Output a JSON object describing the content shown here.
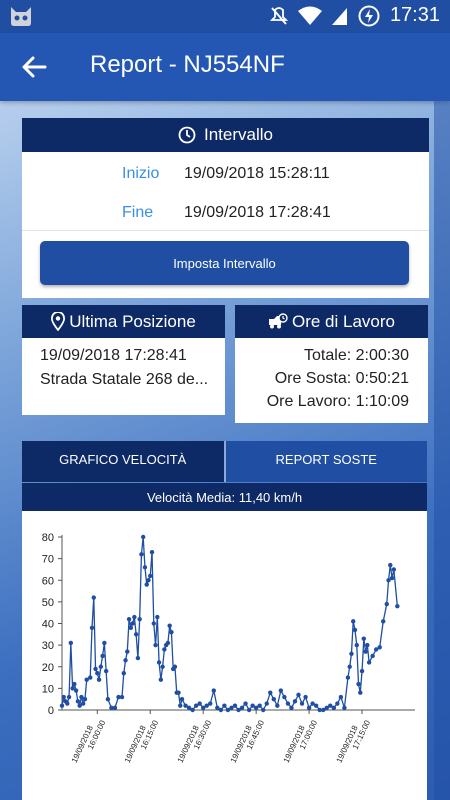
{
  "status_bar": {
    "time": "17:31",
    "icons": [
      "android-cat-icon",
      "mute-icon",
      "wifi-icon",
      "signal-icon",
      "battery-charging-icon"
    ]
  },
  "app_bar": {
    "title": "Report - NJ554NF",
    "back_icon": "arrow-left-icon"
  },
  "interval": {
    "header": "Intervallo",
    "icon": "clock-icon",
    "start_label": "Inizio",
    "start_value": "19/09/2018 15:28:11",
    "end_label": "Fine",
    "end_value": "19/09/2018 17:28:41",
    "button_label": "Imposta Intervallo"
  },
  "last_position": {
    "header": "Ultima Posizione",
    "icon": "location-pin-icon",
    "datetime": "19/09/2018 17:28:41",
    "address": "Strada Statale 268 de..."
  },
  "work_hours": {
    "header": "Ore di Lavoro",
    "icon": "truck-clock-icon",
    "total": "Totale: 2:00:30",
    "stop": "Ore Sosta: 0:50:21",
    "work": "Ore Lavoro: 1:10:09"
  },
  "tabs": [
    {
      "label": "GRAFICO VELOCITÀ",
      "active": true
    },
    {
      "label": "REPORT SOSTE",
      "active": false
    }
  ],
  "average_speed": "Velocità Media: 11,40 km/h",
  "colors": {
    "primary": "#1f4ea3",
    "dark_header": "#0d2a66",
    "accent_label": "#3a8ee6",
    "series": "#1f4ea3"
  },
  "chart_data": {
    "type": "line",
    "title": "",
    "xlabel": "",
    "ylabel": "",
    "ylim": [
      0,
      80
    ],
    "yticks": [
      0,
      10,
      20,
      30,
      40,
      50,
      60,
      70,
      80
    ],
    "x_tick_labels": [
      "19/09/2018 16:00:00",
      "19/09/2018 16:15:00",
      "19/09/2018 16:30:00",
      "19/09/2018 16:45:00",
      "19/09/2018 17:00:00",
      "19/09/2018 17:15:00"
    ],
    "x_range_minutes": [
      "15:50",
      "17:30"
    ],
    "series": [
      {
        "points": [
          [
            "15:50",
            2
          ],
          [
            "15:50:30",
            6
          ],
          [
            "15:51",
            4
          ],
          [
            "15:51:30",
            3
          ],
          [
            "15:52",
            6
          ],
          [
            "15:52:30",
            31
          ],
          [
            "15:53",
            10
          ],
          [
            "15:53:30",
            12
          ],
          [
            "15:54",
            9
          ],
          [
            "15:54:30",
            4
          ],
          [
            "15:55",
            2
          ],
          [
            "15:55:30",
            6
          ],
          [
            "15:56",
            3
          ],
          [
            "15:56:30",
            5
          ],
          [
            "15:57",
            14
          ],
          [
            "15:58",
            15
          ],
          [
            "15:58:30",
            38
          ],
          [
            "15:59",
            52
          ],
          [
            "15:59:30",
            19
          ],
          [
            "16:00",
            17
          ],
          [
            "16:00:30",
            14
          ],
          [
            "16:01",
            20
          ],
          [
            "16:01:30",
            25
          ],
          [
            "16:02",
            31
          ],
          [
            "16:02:30",
            18
          ],
          [
            "16:03",
            5
          ],
          [
            "16:04",
            1
          ],
          [
            "16:05",
            1
          ],
          [
            "16:06",
            6
          ],
          [
            "16:07",
            6
          ],
          [
            "16:07:30",
            17
          ],
          [
            "16:08",
            23
          ],
          [
            "16:08:30",
            27
          ],
          [
            "16:09",
            42
          ],
          [
            "16:09:30",
            38
          ],
          [
            "16:10",
            40
          ],
          [
            "16:10:30",
            43
          ],
          [
            "16:11",
            35
          ],
          [
            "16:11:30",
            24
          ],
          [
            "16:12",
            42
          ],
          [
            "16:12:30",
            72
          ],
          [
            "16:13",
            80
          ],
          [
            "16:13:30",
            66
          ],
          [
            "16:14",
            58
          ],
          [
            "16:14:30",
            60
          ],
          [
            "16:15",
            62
          ],
          [
            "16:15:30",
            73
          ],
          [
            "16:16",
            40
          ],
          [
            "16:16:30",
            30
          ],
          [
            "16:17",
            43
          ],
          [
            "16:17:30",
            22
          ],
          [
            "16:18",
            14
          ],
          [
            "16:18:30",
            20
          ],
          [
            "16:19",
            28
          ],
          [
            "16:19:30",
            30
          ],
          [
            "16:20",
            31
          ],
          [
            "16:20:30",
            39
          ],
          [
            "16:21",
            36
          ],
          [
            "16:21:30",
            19
          ],
          [
            "16:22",
            20
          ],
          [
            "16:22:30",
            8
          ],
          [
            "16:23",
            8
          ],
          [
            "16:23:30",
            2
          ],
          [
            "16:24",
            5
          ],
          [
            "16:25",
            2
          ],
          [
            "16:26",
            1
          ],
          [
            "16:27",
            0
          ],
          [
            "16:28",
            2
          ],
          [
            "16:29",
            3
          ],
          [
            "16:30",
            1
          ],
          [
            "16:31",
            2
          ],
          [
            "16:32",
            3
          ],
          [
            "16:33",
            9
          ],
          [
            "16:34",
            1
          ],
          [
            "16:35",
            0
          ],
          [
            "16:36",
            2
          ],
          [
            "16:37",
            0
          ],
          [
            "16:38",
            1
          ],
          [
            "16:39",
            2
          ],
          [
            "16:40",
            0
          ],
          [
            "16:41",
            1
          ],
          [
            "16:42",
            3
          ],
          [
            "16:43",
            0
          ],
          [
            "16:44",
            2
          ],
          [
            "16:45",
            1
          ],
          [
            "16:46",
            2
          ],
          [
            "16:47",
            0
          ],
          [
            "16:48",
            3
          ],
          [
            "16:49",
            8
          ],
          [
            "16:50",
            5
          ],
          [
            "16:51",
            2
          ],
          [
            "16:52",
            9
          ],
          [
            "16:53",
            6
          ],
          [
            "16:54",
            3
          ],
          [
            "16:55",
            1
          ],
          [
            "16:56",
            4
          ],
          [
            "16:57",
            7
          ],
          [
            "16:58",
            3
          ],
          [
            "16:59",
            6
          ],
          [
            "17:00",
            1
          ],
          [
            "17:01",
            3
          ],
          [
            "17:02",
            2
          ],
          [
            "17:03",
            0
          ],
          [
            "17:04",
            0
          ],
          [
            "17:05",
            1
          ],
          [
            "17:06",
            2
          ],
          [
            "17:07",
            1
          ],
          [
            "17:08",
            3
          ],
          [
            "17:09",
            6
          ],
          [
            "17:10",
            1
          ],
          [
            "17:11",
            15
          ],
          [
            "17:11:30",
            20
          ],
          [
            "17:12",
            26
          ],
          [
            "17:12:30",
            41
          ],
          [
            "17:13",
            37
          ],
          [
            "17:13:30",
            30
          ],
          [
            "17:14",
            12
          ],
          [
            "17:14:30",
            8
          ],
          [
            "17:15",
            18
          ],
          [
            "17:15:30",
            33
          ],
          [
            "17:16",
            27
          ],
          [
            "17:16:30",
            30
          ],
          [
            "17:17",
            22
          ],
          [
            "17:18",
            25
          ],
          [
            "17:19",
            28
          ],
          [
            "17:20",
            29
          ],
          [
            "17:21",
            41
          ],
          [
            "17:22",
            49
          ],
          [
            "17:22:30",
            60
          ],
          [
            "17:23",
            67
          ],
          [
            "17:23:30",
            61
          ],
          [
            "17:24",
            65
          ],
          [
            "17:25",
            48
          ]
        ]
      }
    ],
    "marker": "circle",
    "grid": false
  }
}
